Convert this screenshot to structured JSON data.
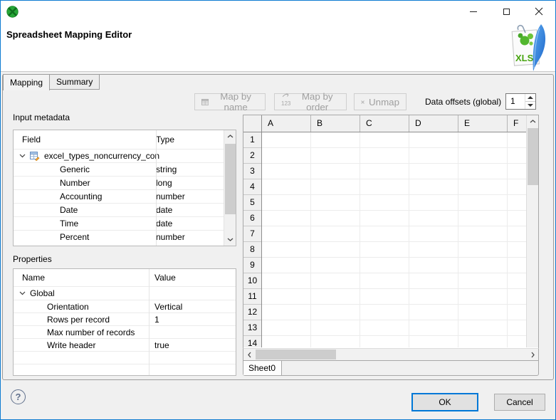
{
  "window": {
    "header_title": "Spreadsheet Mapping Editor",
    "xls_badge": "XLS"
  },
  "tabs": {
    "mapping": "Mapping",
    "summary": "Summary"
  },
  "toolbar": {
    "map_by_name_label": "Map by name",
    "map_by_order_label": "Map by order",
    "map_by_order_icon_text": "123",
    "unmap_label": "Unmap",
    "data_offsets_label": "Data offsets (global)",
    "data_offsets_value": "1"
  },
  "input_metadata": {
    "section_label": "Input metadata",
    "col_field": "Field",
    "col_type": "Type",
    "root_record": "excel_types_noncurrency_con",
    "rows": [
      {
        "field": "Generic",
        "type": "string"
      },
      {
        "field": "Number",
        "type": "long"
      },
      {
        "field": "Accounting",
        "type": "number"
      },
      {
        "field": "Date",
        "type": "date"
      },
      {
        "field": "Time",
        "type": "date"
      },
      {
        "field": "Percent",
        "type": "number"
      }
    ]
  },
  "properties": {
    "section_label": "Properties",
    "col_name": "Name",
    "col_value": "Value",
    "root_group": "Global",
    "rows": [
      {
        "name": "Orientation",
        "value": "Vertical"
      },
      {
        "name": "Rows per record",
        "value": "1"
      },
      {
        "name": "Max number of records",
        "value": ""
      },
      {
        "name": "Write header",
        "value": "true"
      }
    ]
  },
  "grid": {
    "columns": [
      "A",
      "B",
      "C",
      "D",
      "E",
      "F"
    ],
    "rows": [
      "1",
      "2",
      "3",
      "4",
      "5",
      "6",
      "7",
      "8",
      "9",
      "10",
      "11",
      "12",
      "13",
      "14"
    ],
    "sheet_tab": "Sheet0"
  },
  "footer": {
    "help_symbol": "?",
    "ok_label": "OK",
    "cancel_label": "Cancel"
  },
  "colors": {
    "window_border": "#0f7cd1",
    "logo_green": "#27a737",
    "xls_text_green": "#49a512",
    "feather_blue": "#2e7fdd",
    "ok_focus_blue": "#0078d7"
  }
}
